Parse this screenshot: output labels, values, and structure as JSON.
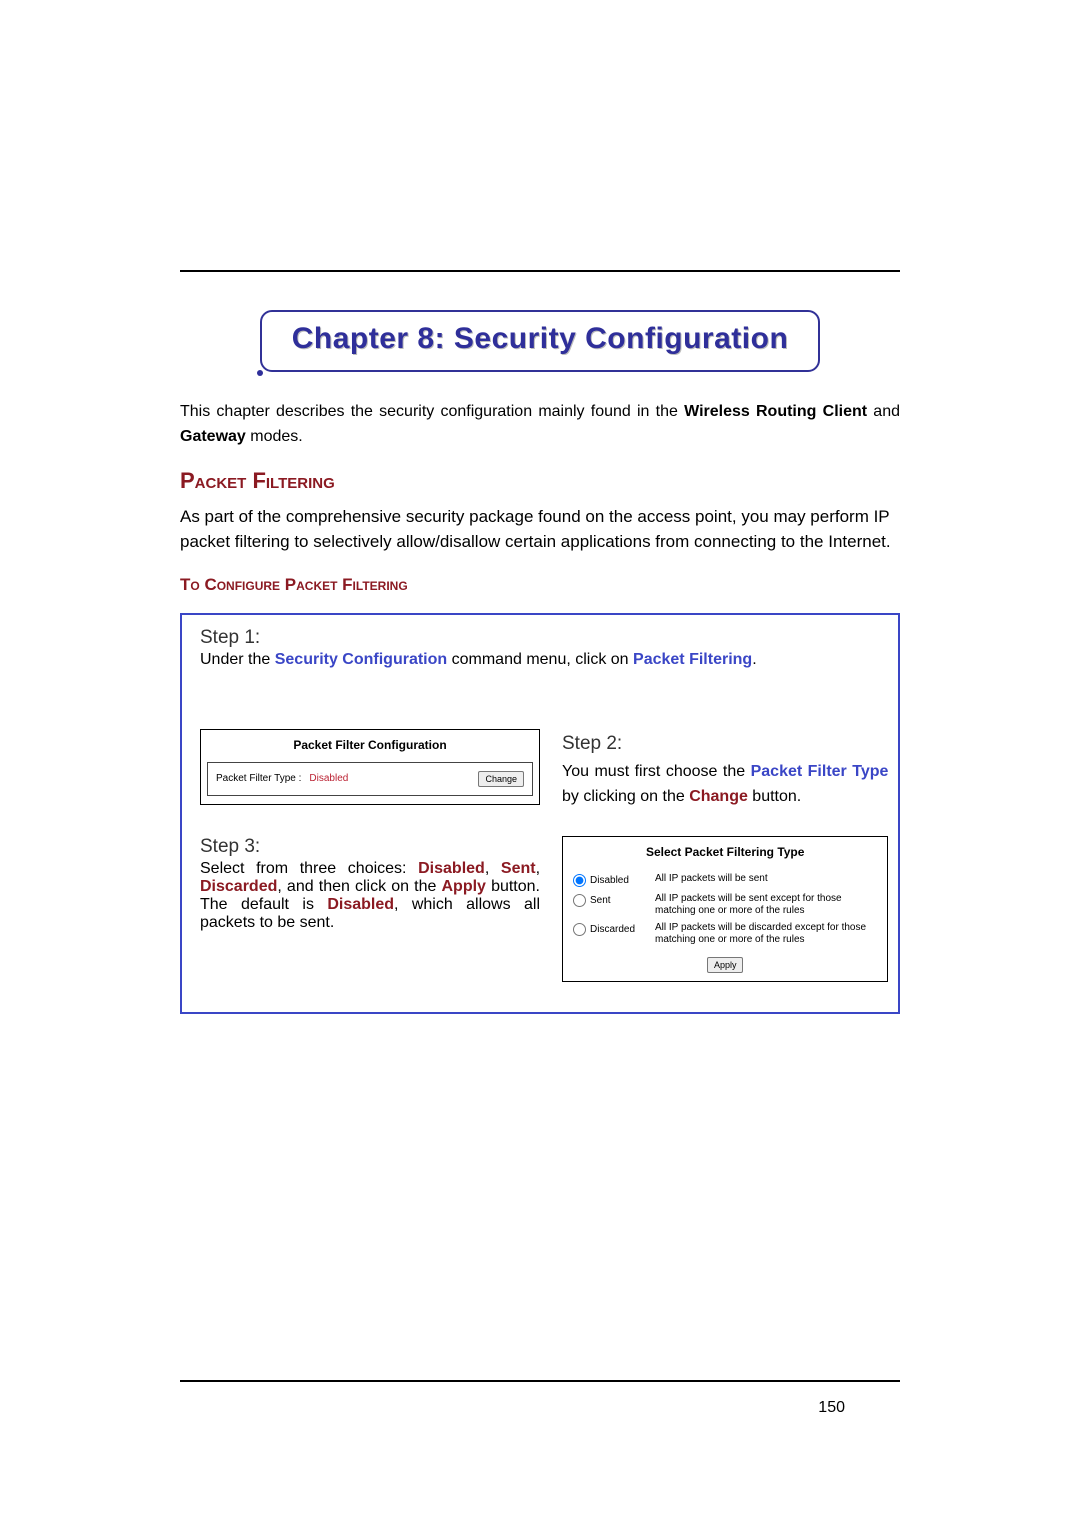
{
  "page_number": "150",
  "chapter_title": "Chapter 8: Security Configuration",
  "intro": {
    "t1": "This chapter describes the security configuration mainly found in the ",
    "wrc": "Wireless Routing Client",
    "and": " and ",
    "gw": "Gateway",
    "t2": " modes."
  },
  "h_packet": "Packet Filtering",
  "packet_para": "As part of the comprehensive security package found on the access point, you may perform IP packet filtering to selectively allow/disallow certain applications from connecting to the Internet.",
  "h_config": "To Configure Packet Filtering",
  "step1": {
    "label": "Step 1:",
    "t1": "Under the ",
    "sc": "Security Configuration",
    "t2": " command menu, click on ",
    "pf": "Packet Filtering",
    "t3": "."
  },
  "shot1": {
    "title": "Packet Filter Configuration",
    "label": "Packet Filter Type :",
    "value": "Disabled",
    "btn": "Change"
  },
  "step2": {
    "label": "Step 2:",
    "t1": "You must first choose the ",
    "pft": "Packet Filter Type",
    "t2": " by clicking on the ",
    "chg": "Change",
    "t3": " button."
  },
  "step3": {
    "label": "Step 3:",
    "t1": "Select from three choices: ",
    "d": "Disabled",
    "c1": ", ",
    "s": "Sent",
    "c2": ", ",
    "dc": "Discarded",
    "t2": ", and then click on the ",
    "ap": "Apply",
    "t3": " button. The default is ",
    "d2": "Disabled",
    "t4": ", which allows all packets to be sent."
  },
  "shot2": {
    "title": "Select Packet Filtering Type",
    "opts": [
      {
        "name": "Disabled",
        "desc": "All IP packets will be sent"
      },
      {
        "name": "Sent",
        "desc": "All IP packets will be sent except for those matching one or more of the rules"
      },
      {
        "name": "Discarded",
        "desc": "All IP packets will be discarded except for those matching one or more of the rules"
      }
    ],
    "apply": "Apply"
  }
}
